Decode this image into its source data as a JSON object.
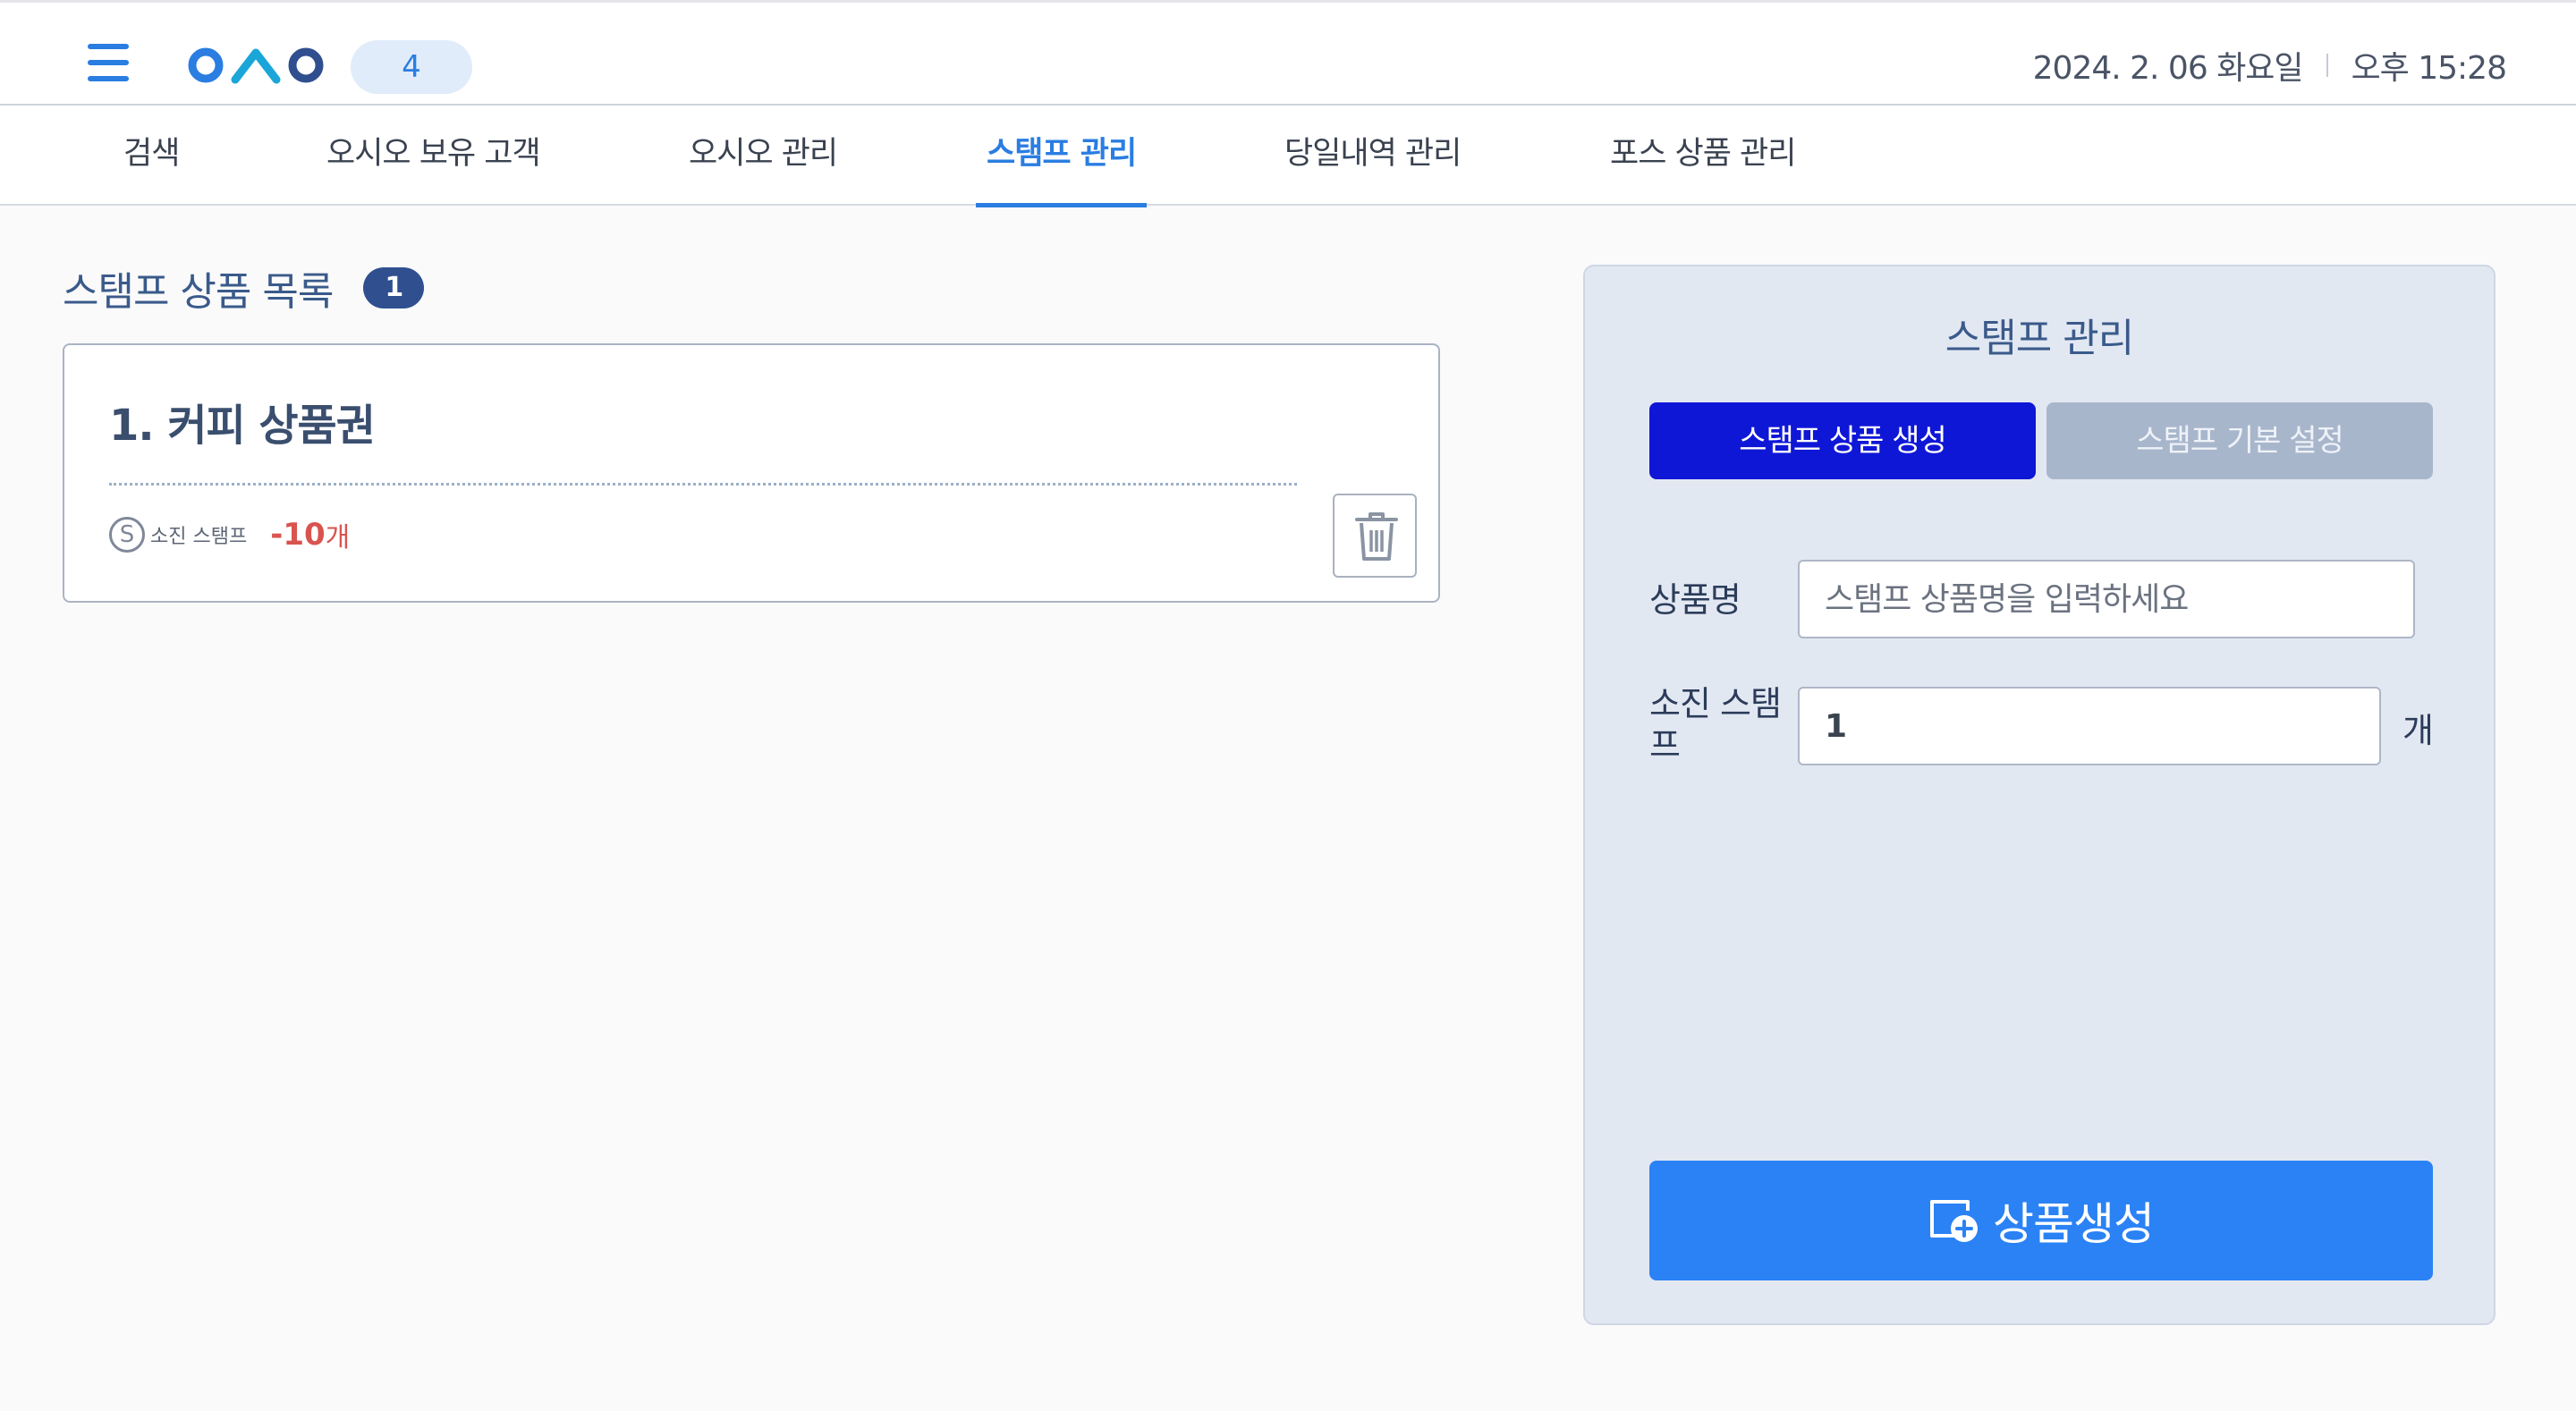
{
  "header": {
    "badge_count": "4",
    "date": "2024. 2. 06 화요일",
    "time": "오후 15:28"
  },
  "nav": {
    "tabs": [
      {
        "label": "검색"
      },
      {
        "label": "오시오 보유 고객"
      },
      {
        "label": "오시오 관리"
      },
      {
        "label": "스탬프 관리",
        "active": true
      },
      {
        "label": "당일내역 관리"
      },
      {
        "label": "포스 상품 관리"
      }
    ]
  },
  "list": {
    "title": "스탬프 상품 목록",
    "count": "1",
    "items": [
      {
        "title": "1. 커피 상품권",
        "stamp_icon_text": "S",
        "stamp_label": "소진 스탬프",
        "stamp_value": "-10",
        "stamp_unit": "개"
      }
    ]
  },
  "panel": {
    "title": "스탬프 관리",
    "seg_create": "스탬프 상품 생성",
    "seg_settings": "스탬프 기본 설정",
    "name_label": "상품명",
    "name_placeholder": "스탬프 상품명을 입력하세요",
    "name_value": "",
    "stamp_label_line1": "소진 스탬",
    "stamp_label_line2": "프",
    "stamp_value": "1",
    "stamp_unit": "개",
    "create_button": "상품생성"
  },
  "colors": {
    "accent": "#2a7de1",
    "primary_button": "#2a82f5",
    "active_segment": "#0f17d6",
    "inactive_segment": "#a8b6cc",
    "negative_value": "#d9534f",
    "count_badge": "#2f4f8f"
  }
}
